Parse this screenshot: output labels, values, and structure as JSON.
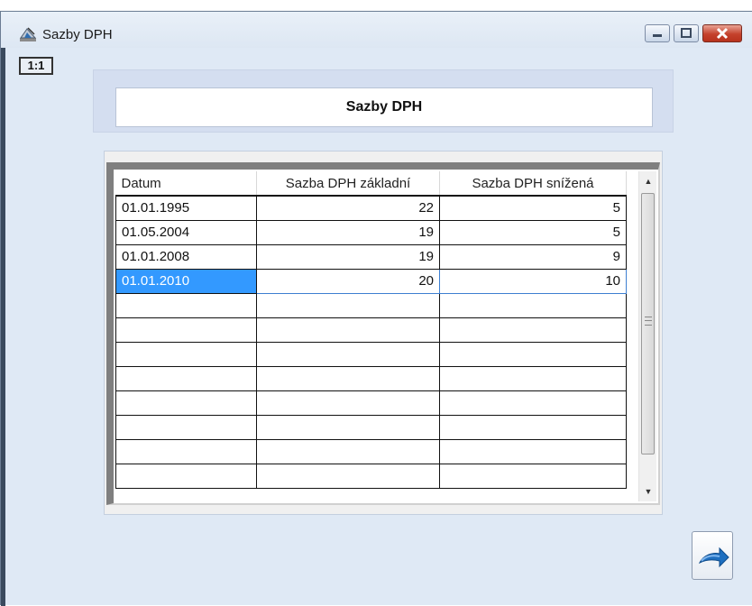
{
  "window": {
    "title": "Sazby DPH",
    "icon": "app-icon",
    "controls": [
      "minimize-icon",
      "maximize-icon",
      "close-icon"
    ]
  },
  "zoom_badge": "1:1",
  "header": {
    "title": "Sazby DPH"
  },
  "grid": {
    "columns": [
      "Datum",
      "Sazba DPH základní",
      "Sazba DPH snížená"
    ],
    "rows": [
      {
        "date": "01.01.1995",
        "base": "22",
        "reduced": "5"
      },
      {
        "date": "01.05.2004",
        "base": "19",
        "reduced": "5"
      },
      {
        "date": "01.01.2008",
        "base": "19",
        "reduced": "9"
      },
      {
        "date": "01.01.2010",
        "base": "20",
        "reduced": "10"
      }
    ],
    "selected_row": 3,
    "empty_rows": 8
  },
  "colors": {
    "selection": "#3399ff",
    "window_bg": "#dfe9f5",
    "close_button": "#c4412c"
  },
  "action_button": {
    "icon": "return-arrow-icon"
  }
}
